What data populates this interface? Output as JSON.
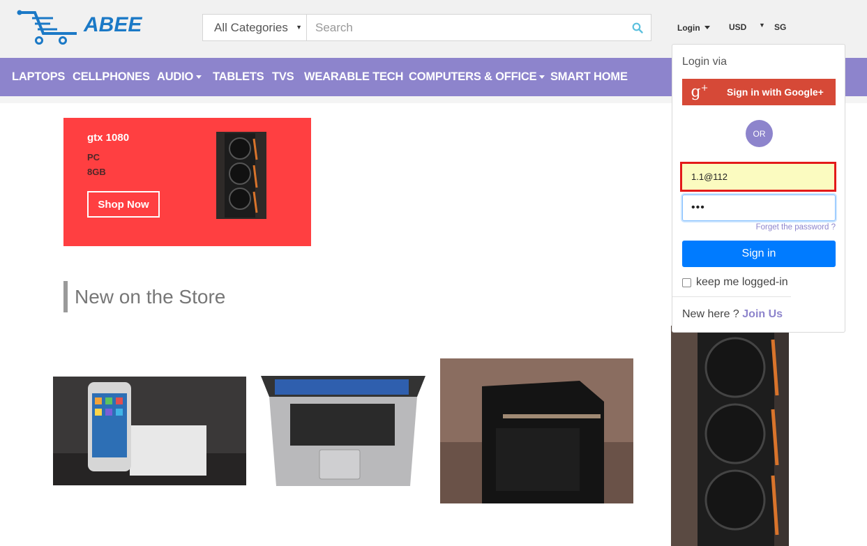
{
  "header": {
    "logo_text": "ABEE",
    "category_select": "All Categories",
    "search_placeholder": "Search",
    "login_label": "Login",
    "currency": "USD",
    "region": "SG"
  },
  "nav": {
    "items": [
      {
        "label": "LAPTOPS"
      },
      {
        "label": "CELLPHONES"
      },
      {
        "label": "AUDIO"
      },
      {
        "label": "TABLETS"
      },
      {
        "label": "TVS"
      },
      {
        "label": "WEARABLE TECH"
      },
      {
        "label": "COMPUTERS & OFFICE"
      },
      {
        "label": "SMART HOME"
      }
    ]
  },
  "banner": {
    "title": "gtx 1080",
    "line1": "PC",
    "line2": "8GB",
    "button": "Shop Now"
  },
  "section": {
    "title": "New on the Store"
  },
  "products": [
    {
      "name": "iphone-image"
    },
    {
      "name": "laptop-image"
    },
    {
      "name": "pc-case-image"
    },
    {
      "name": "gpu-image"
    }
  ],
  "login": {
    "via_label": "Login via",
    "google_label": "Sign in with Google+",
    "or_label": "OR",
    "email_value": "1.1@112",
    "password_mask": "•••",
    "forget_label": "Forget the password ?",
    "signin_label": "Sign in",
    "keep_label": "keep me logged-in",
    "new_here_label": "New here ?",
    "join_label": "Join Us"
  },
  "colors": {
    "nav_bg": "#8d84cc",
    "banner_bg": "#ff3f41",
    "signin_btn": "#007bff",
    "google_btn": "#d64937",
    "highlight_border": "#e31a1a",
    "logo_blue": "#1b79c6"
  }
}
